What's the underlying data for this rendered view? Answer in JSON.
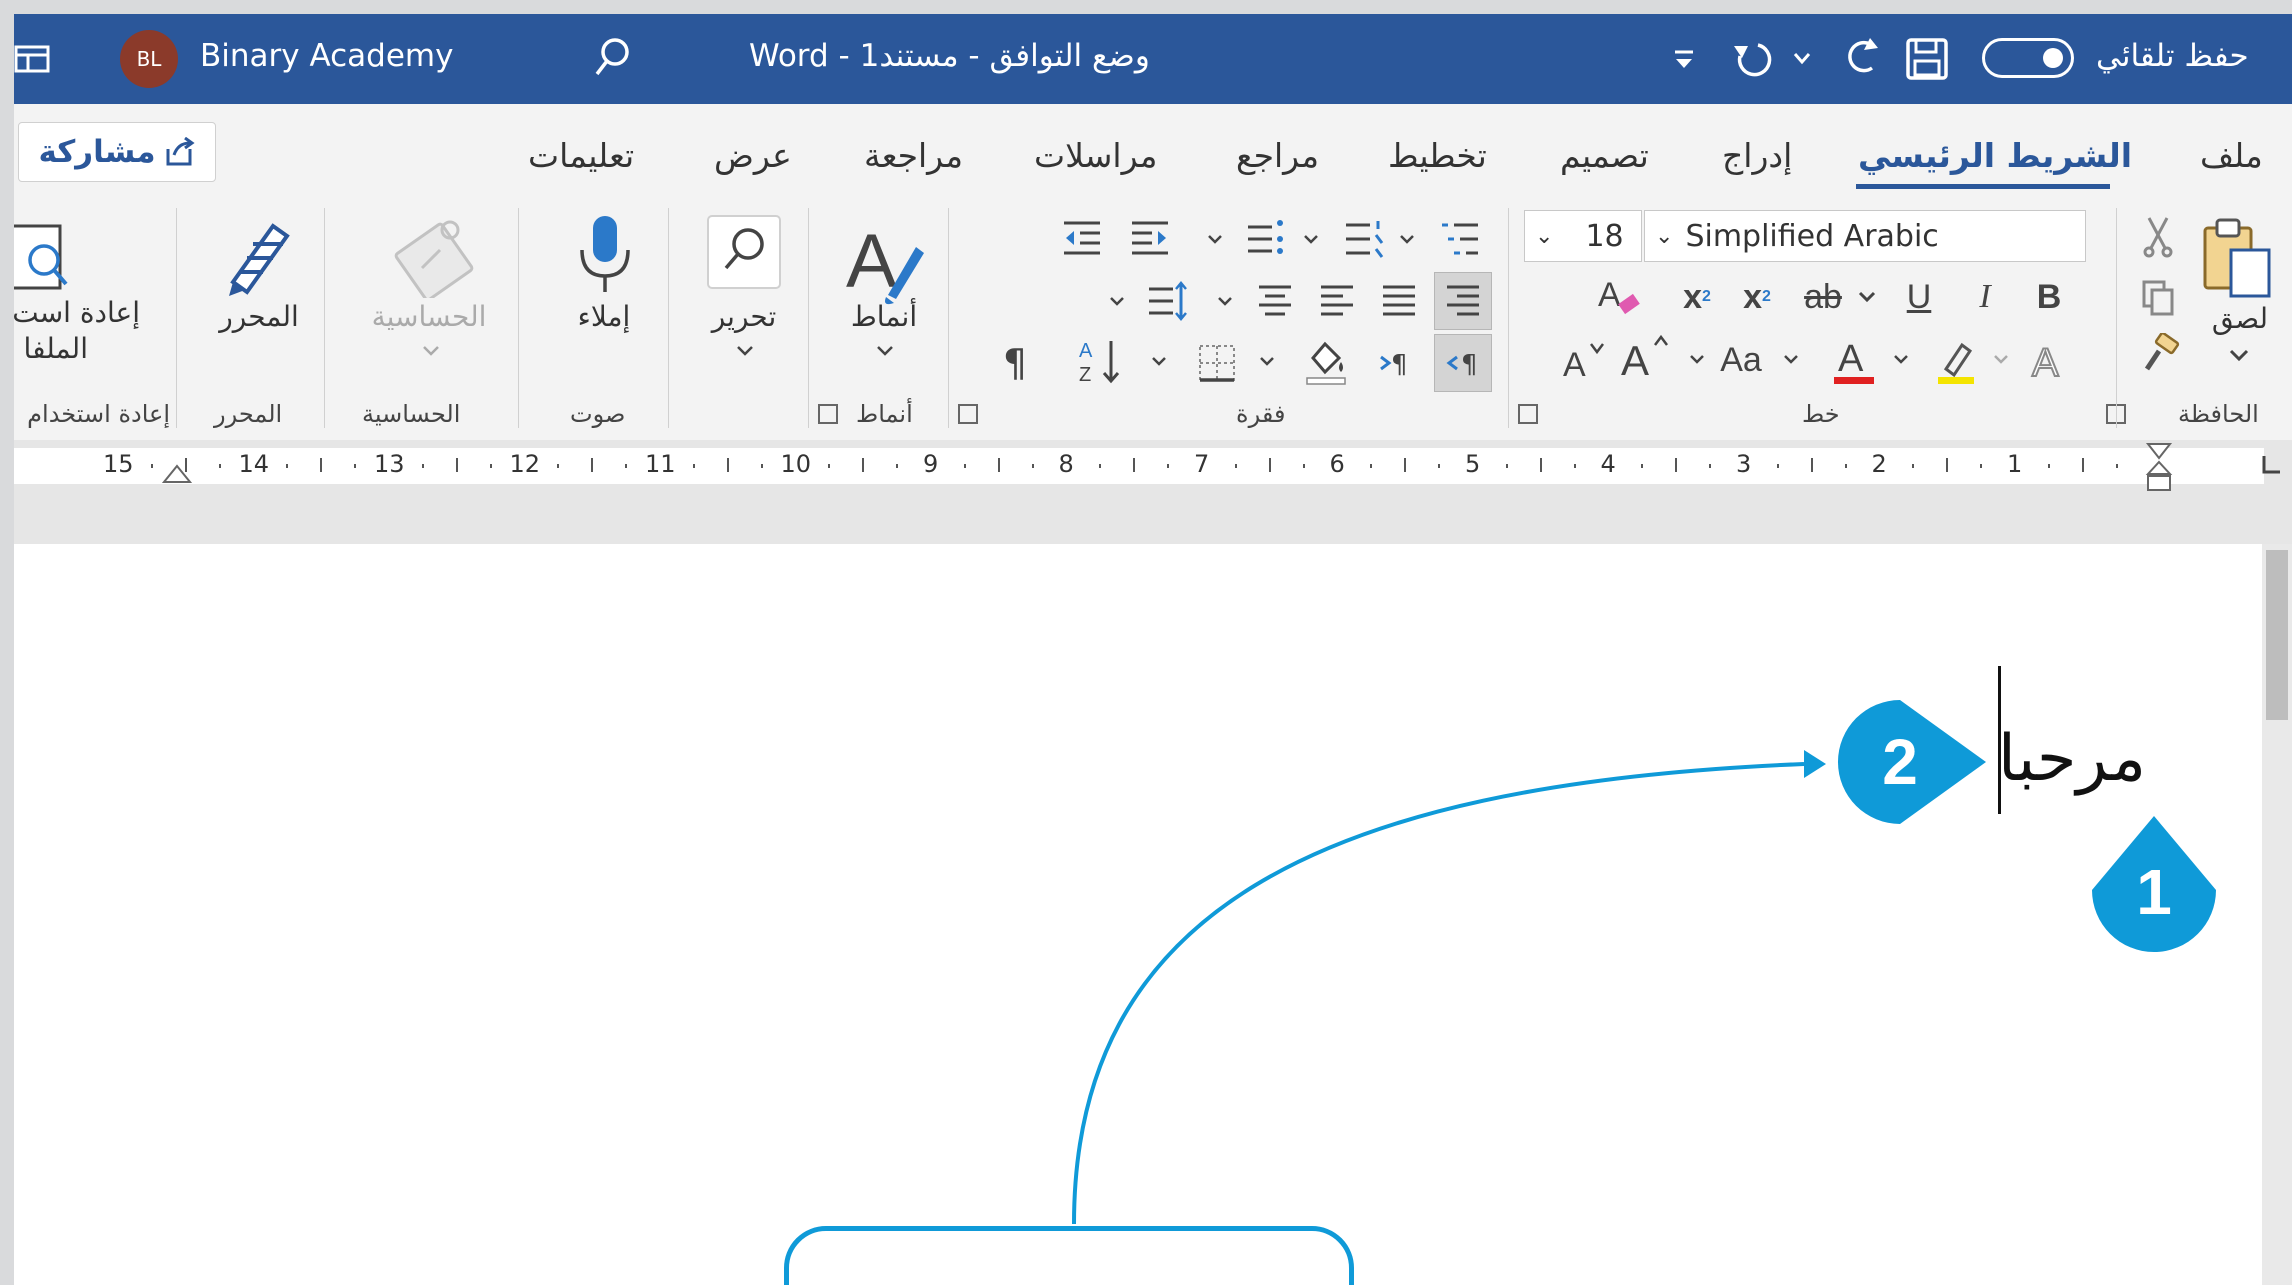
{
  "titlebar": {
    "app_icon": "layout-icon",
    "user_initials": "BL",
    "user_name": "Binary Academy",
    "search_icon": "search-icon",
    "doc_title": "Word - وضع التوافق - مستند1",
    "autosave_label": "حفظ تلقائي",
    "autosave_on": true
  },
  "menu": {
    "share_label": "مشاركة",
    "tabs": [
      "ملف",
      "الشريط الرئيسي",
      "إدراج",
      "تصميم",
      "تخطيط",
      "مراجع",
      "مراسلات",
      "مراجعة",
      "عرض",
      "تعليمات"
    ],
    "active_tab": "الشريط الرئيسي"
  },
  "ribbon": {
    "clipboard": {
      "paste_label": "لصق",
      "group_label": "الحافظة"
    },
    "font": {
      "font_name": "Simplified Arabic",
      "font_size": "18",
      "case_label": "Aa",
      "group_label": "خط"
    },
    "paragraph": {
      "group_label": "فقرة"
    },
    "styles": {
      "label": "أنماط",
      "group_label": "أنماط"
    },
    "editing": {
      "label": "تحرير"
    },
    "voice": {
      "label": "إملاء",
      "group_label": "صوت"
    },
    "sensitivity": {
      "label": "الحساسية",
      "group_label": "الحساسية"
    },
    "editor": {
      "label": "المحرر",
      "group_label": "المحرر"
    },
    "reuse": {
      "label_line1": "إعادة است",
      "label_line2": "الملفا",
      "group_label": "إعادة استخدام"
    }
  },
  "ruler": {
    "numbers": [
      "1",
      "2",
      "3",
      "4",
      "5",
      "6",
      "7",
      "8",
      "9",
      "10",
      "11",
      "12",
      "13",
      "14",
      "15"
    ]
  },
  "document": {
    "text": "مرحبا"
  },
  "callouts": {
    "one": "1",
    "two": "2"
  },
  "colors": {
    "title_bar": "#2b579a",
    "callout": "#0f9ad8"
  }
}
